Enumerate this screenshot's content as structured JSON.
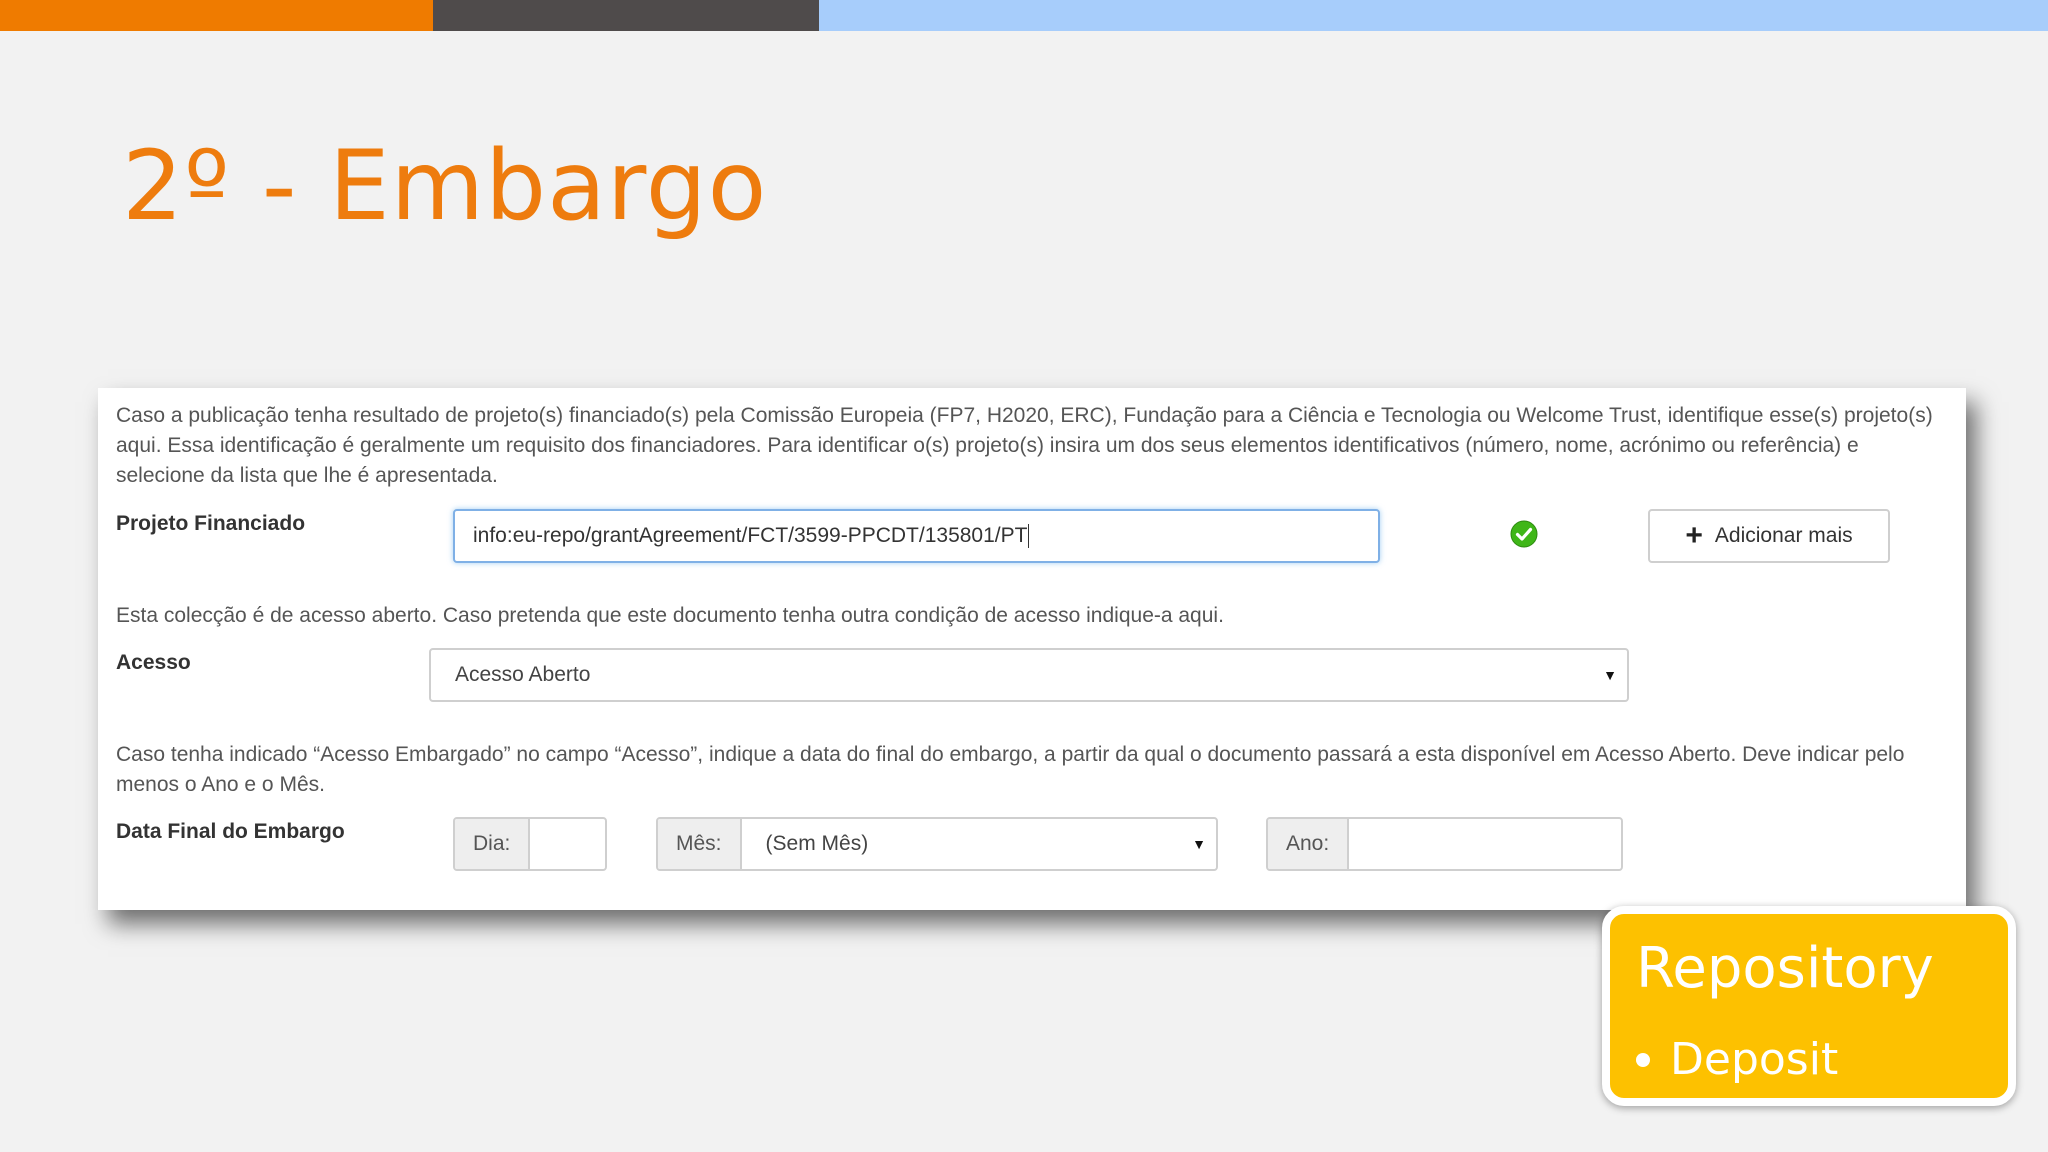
{
  "slide": {
    "title": "2º - Embargo"
  },
  "form": {
    "help_projeto": "Caso a publicação tenha resultado de projeto(s) financiado(s) pela Comissão Europeia (FP7, H2020, ERC), Fundação para a Ciência e Tecnologia ou Welcome Trust, identifique esse(s) projeto(s) aqui. Essa identificação é geralmente um requisito dos financiadores. Para identificar o(s) projeto(s) insira um dos seus elementos identificativos (número, nome, acrónimo ou referência) e selecione da lista que lhe é apresentada.",
    "label_projeto": "Projeto Financiado",
    "projeto_value": "info:eu-repo/grantAgreement/FCT/3599-PPCDT/135801/PT",
    "add_more_label": "Adicionar mais",
    "help_acesso": "Esta colecção é de acesso aberto. Caso pretenda que este documento tenha outra condição de acesso indique-a aqui.",
    "label_acesso": "Acesso",
    "acesso_selected": "Acesso Aberto",
    "help_embargo": "Caso tenha indicado “Acesso Embargado” no campo “Acesso”, indique a data do final do embargo, a partir da qual o documento passará a esta disponível em Acesso Aberto. Deve indicar pelo menos o Ano e o Mês.",
    "label_data": "Data Final do Embargo",
    "dia_label": "Dia:",
    "dia_value": "",
    "mes_label": "Mês:",
    "mes_selected": "(Sem Mês)",
    "ano_label": "Ano:",
    "ano_value": ""
  },
  "badge": {
    "title": "Repository",
    "item": "Deposit"
  },
  "colors": {
    "accent_orange": "#ee7c0e",
    "bar_dark": "#4f4b4b",
    "bar_light_blue": "#a7cdfb",
    "badge_yellow": "#fdc100",
    "check_green": "#3fb618"
  }
}
